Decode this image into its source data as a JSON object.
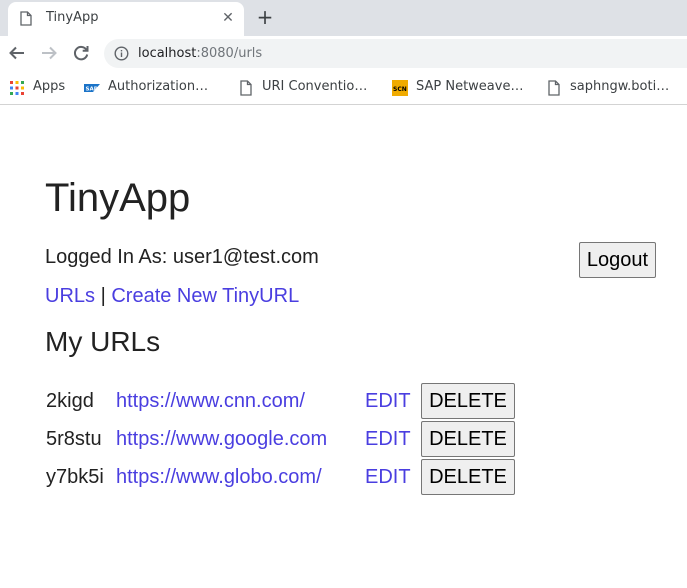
{
  "browser": {
    "tab_title": "TinyApp",
    "new_tab_symbol": "+",
    "close_symbol": "✕",
    "url_host": "localhost",
    "url_rest": ":8080/urls",
    "bookmarks": [
      {
        "label": "Apps",
        "icon": "apps-grid-icon"
      },
      {
        "label": "Authorization…",
        "icon": "sap-logo-icon"
      },
      {
        "label": "URI Conventio…",
        "icon": "page-icon"
      },
      {
        "label": "SAP Netweave…",
        "icon": "scn-logo-icon"
      },
      {
        "label": "saphngw.boti…",
        "icon": "page-icon"
      }
    ]
  },
  "app": {
    "title": "TinyApp",
    "logged_in_text": "Logged In As: user1@test.com",
    "logout_label": "Logout",
    "nav": {
      "urls_label": "URLs",
      "separator": "|",
      "create_label": "Create New TinyURL"
    },
    "section_title": "My URLs",
    "edit_label": "EDIT",
    "delete_label": "DELETE",
    "urls": [
      {
        "short": "2kigd",
        "long": "https://www.cnn.com/"
      },
      {
        "short": "5r8stu",
        "long": "https://www.google.com"
      },
      {
        "short": "y7bk5i",
        "long": "https://www.globo.com/"
      }
    ]
  },
  "colors": {
    "link": "#4a3ee0",
    "tabstrip": "#dee1e6",
    "omnibox": "#f1f3f4"
  }
}
